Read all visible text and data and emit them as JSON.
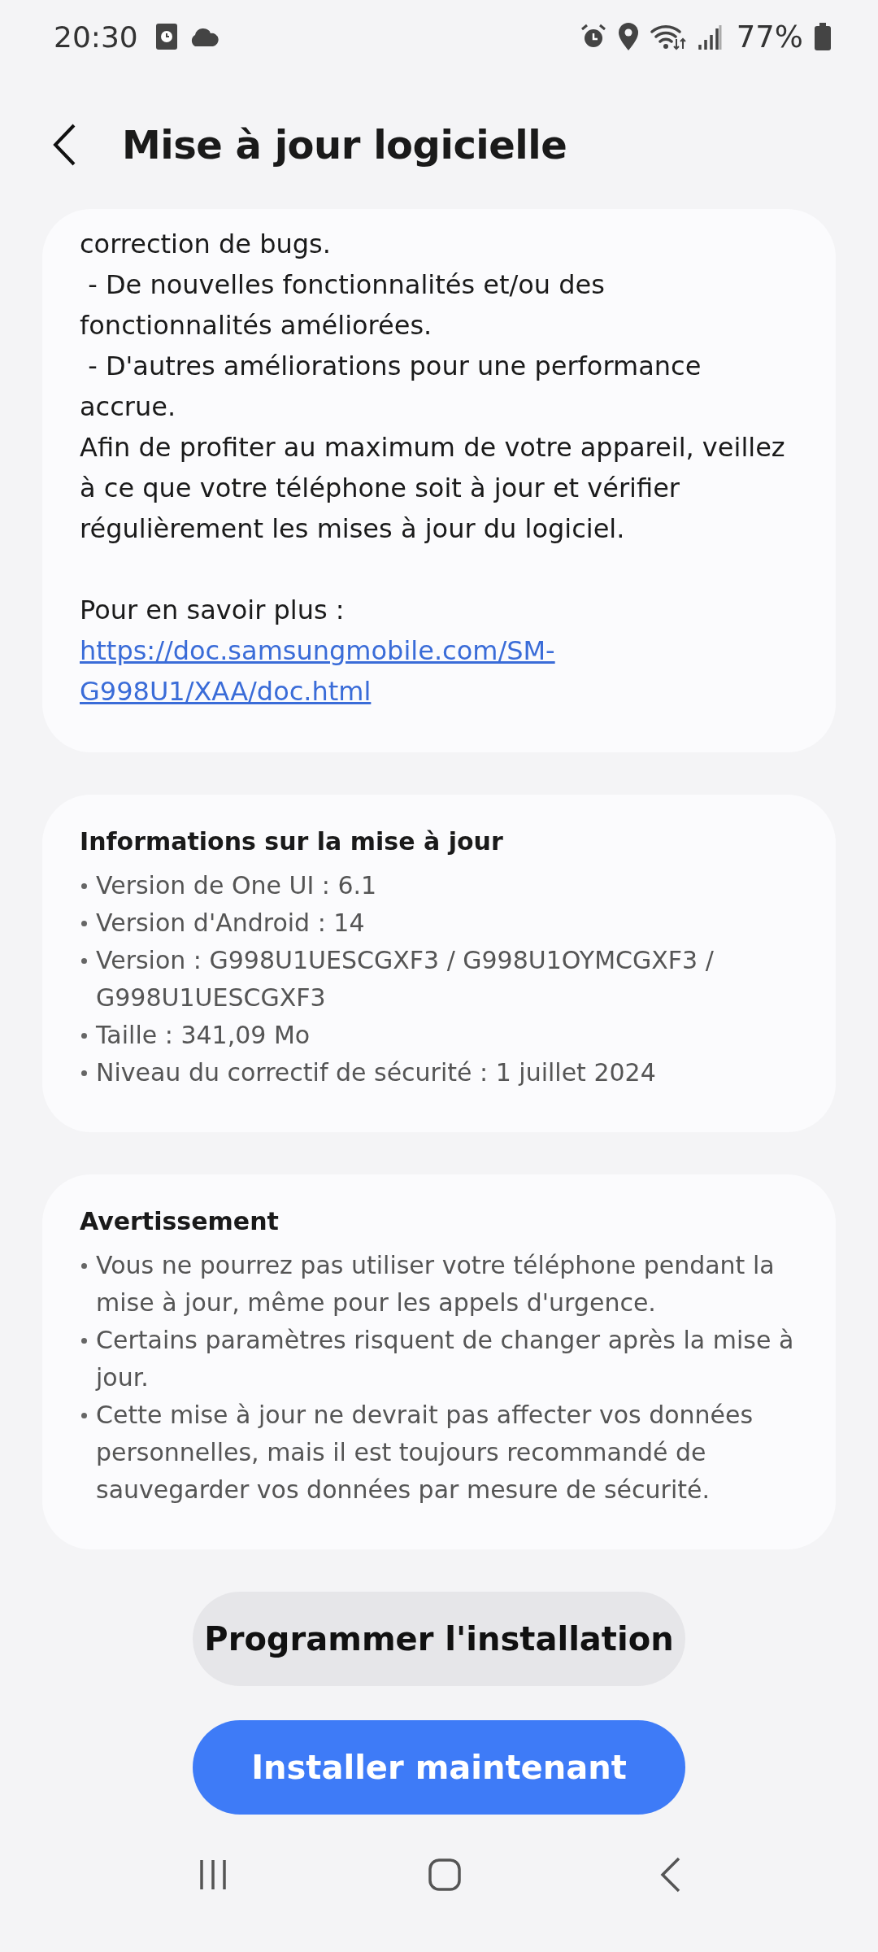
{
  "status_bar": {
    "time": "20:30",
    "battery": "77%"
  },
  "header": {
    "title": "Mise à jour logicielle"
  },
  "notes": {
    "paragraphs": [
      "correction de bugs.",
      " - De nouvelles fonctionnalités et/ou des fonctionnalités améliorées.",
      " - D'autres améliorations pour une performance accrue.",
      "Afin de profiter au maximum de votre appareil, veillez à ce que votre téléphone soit à jour et vérifier régulièrement les mises à jour du logiciel."
    ],
    "more_label": "Pour en savoir plus :",
    "link": "https://doc.samsungmobile.com/SM-G998U1/XAA/doc.html"
  },
  "info": {
    "title": "Informations sur la mise à jour",
    "items": [
      "Version de One UI : 6.1",
      "Version d'Android : 14",
      "Version : G998U1UESCGXF3 / G998U1OYMCGXF3 / G998U1UESCGXF3",
      "Taille : 341,09 Mo",
      "Niveau du correctif de sécurité : 1 juillet 2024"
    ]
  },
  "warning": {
    "title": "Avertissement",
    "items": [
      "Vous ne pourrez pas utiliser votre téléphone pendant la mise à jour, même pour les appels d'urgence.",
      "Certains paramètres risquent de changer après la mise à jour.",
      "Cette mise à jour ne devrait pas affecter vos données personnelles, mais il est toujours recommandé de sauvegarder vos données par mesure de sécurité."
    ]
  },
  "buttons": [
    {
      "label": "Programmer l'installation",
      "kind": "secondary"
    },
    {
      "label": "Installer maintenant",
      "kind": "primary"
    }
  ]
}
